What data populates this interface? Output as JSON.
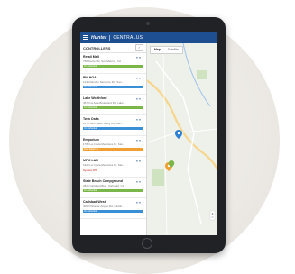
{
  "app": {
    "logo": "Hunter",
    "product": "CENTRALUS"
  },
  "controllers_panel": {
    "title": "CONTROLLERS",
    "check_icon": "✓",
    "items": [
      {
        "name": "Retail Mall",
        "address": "750 Center St, San Marcos, CA",
        "icon": "≡ ≡",
        "status": "On Schedule",
        "status_color": "#7ab648",
        "status_style": "bar"
      },
      {
        "name": "PW HOA",
        "address": "1234 Rancho Santa Fe Rd, San...",
        "icon": "≡ ≡",
        "status": "On Schedule",
        "status_color": "#3a8fd6",
        "status_style": "bar"
      },
      {
        "name": "Lake Worthford",
        "address": "4570 La Jara Boulevard Rd, Lake...",
        "icon": "≡ ≡",
        "status": "On Schedule",
        "status_color": "#7ab648",
        "status_style": "bar"
      },
      {
        "name": "Twin Oaks",
        "address": "1475 Twin Oaks Valley Rd, San...",
        "icon": "≡ ≡",
        "status": "On Schedule",
        "status_color": "#3a8fd6",
        "status_style": "bar"
      },
      {
        "name": "Emporium",
        "address": "1780 La Costa Meadows Dr, San...",
        "icon": "≡ ≡",
        "status": "Run Station 1...",
        "status_color": "#f0a030",
        "status_style": "bar"
      },
      {
        "name": "MPM LAN",
        "address": "1940 La Costa Meadows Dr, San...",
        "icon": "≡ ≡",
        "status": "System Off",
        "status_color": "#d9534f",
        "status_style": "alert"
      },
      {
        "name": "State Beach Campground",
        "address": "2625 Carlsbad Blvd, Carlsbad, CA",
        "icon": "≡ ≡",
        "status": "On Schedule",
        "status_color": "#7ab648",
        "status_style": "bar"
      },
      {
        "name": "Carlsbad West",
        "address": "4000 Palomar Airport Rd, Carlsb...",
        "icon": "≡ ≡",
        "status": "On Schedule",
        "status_color": "#3a8fd6",
        "status_style": "bar"
      }
    ]
  },
  "map": {
    "tabs": [
      "Map",
      "Satellite"
    ],
    "active_tab": "Map",
    "marker_colors": {
      "blue": "#2d7fd3",
      "orange": "#f0a030",
      "green": "#7ab648",
      "water": "#9fc3e8",
      "road": "#f7d58a",
      "park": "#cfe3c0"
    }
  }
}
